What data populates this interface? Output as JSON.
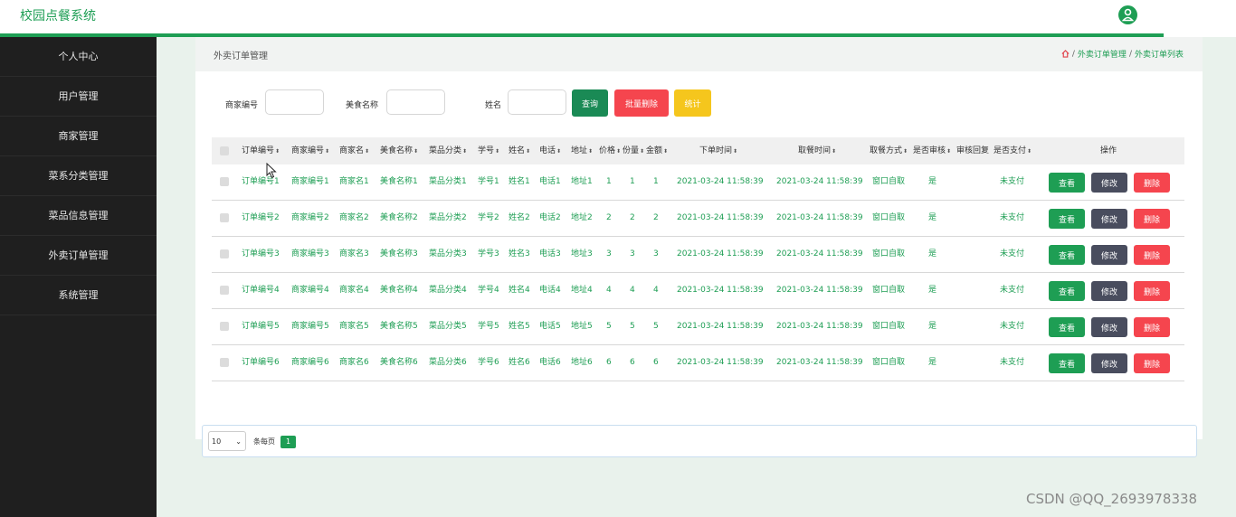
{
  "app": {
    "title": "校园点餐系统"
  },
  "sidebar": {
    "items": [
      {
        "label": "个人中心"
      },
      {
        "label": "用户管理"
      },
      {
        "label": "商家管理"
      },
      {
        "label": "菜系分类管理"
      },
      {
        "label": "菜品信息管理"
      },
      {
        "label": "外卖订单管理"
      },
      {
        "label": "系统管理"
      }
    ]
  },
  "page": {
    "title": "外卖订单管理",
    "breadcrumb": {
      "home_icon": "home-icon",
      "section": "外卖订单管理",
      "current": "外卖订单列表"
    }
  },
  "search": {
    "merchant_id_label": "商家编号",
    "merchant_id_value": "",
    "food_name_label": "美食名称",
    "food_name_value": "",
    "name_label": "姓名",
    "name_value": "",
    "query_button": "查询",
    "batch_delete_button": "批量删除",
    "stats_button": "统计"
  },
  "table": {
    "headers": [
      "订单编号",
      "商家编号",
      "商家名",
      "美食名称",
      "菜品分类",
      "学号",
      "姓名",
      "电话",
      "地址",
      "价格",
      "份量",
      "金额",
      "下单时间",
      "取餐时间",
      "取餐方式",
      "是否审核",
      "审核回复",
      "是否支付",
      "操作"
    ],
    "rows": [
      [
        "订单编号1",
        "商家编号1",
        "商家名1",
        "美食名称1",
        "菜品分类1",
        "学号1",
        "姓名1",
        "电话1",
        "地址1",
        "1",
        "1",
        "1",
        "2021-03-24 11:58:39",
        "2021-03-24 11:58:39",
        "窗口自取",
        "是",
        "",
        "未支付"
      ],
      [
        "订单编号2",
        "商家编号2",
        "商家名2",
        "美食名称2",
        "菜品分类2",
        "学号2",
        "姓名2",
        "电话2",
        "地址2",
        "2",
        "2",
        "2",
        "2021-03-24 11:58:39",
        "2021-03-24 11:58:39",
        "窗口自取",
        "是",
        "",
        "未支付"
      ],
      [
        "订单编号3",
        "商家编号3",
        "商家名3",
        "美食名称3",
        "菜品分类3",
        "学号3",
        "姓名3",
        "电话3",
        "地址3",
        "3",
        "3",
        "3",
        "2021-03-24 11:58:39",
        "2021-03-24 11:58:39",
        "窗口自取",
        "是",
        "",
        "未支付"
      ],
      [
        "订单编号4",
        "商家编号4",
        "商家名4",
        "美食名称4",
        "菜品分类4",
        "学号4",
        "姓名4",
        "电话4",
        "地址4",
        "4",
        "4",
        "4",
        "2021-03-24 11:58:39",
        "2021-03-24 11:58:39",
        "窗口自取",
        "是",
        "",
        "未支付"
      ],
      [
        "订单编号5",
        "商家编号5",
        "商家名5",
        "美食名称5",
        "菜品分类5",
        "学号5",
        "姓名5",
        "电话5",
        "地址5",
        "5",
        "5",
        "5",
        "2021-03-24 11:58:39",
        "2021-03-24 11:58:39",
        "窗口自取",
        "是",
        "",
        "未支付"
      ],
      [
        "订单编号6",
        "商家编号6",
        "商家名6",
        "美食名称6",
        "菜品分类6",
        "学号6",
        "姓名6",
        "电话6",
        "地址6",
        "6",
        "6",
        "6",
        "2021-03-24 11:58:39",
        "2021-03-24 11:58:39",
        "窗口自取",
        "是",
        "",
        "未支付"
      ]
    ],
    "actions": {
      "view": "查看",
      "edit": "修改",
      "delete": "删除"
    }
  },
  "pagination": {
    "page_size": "10",
    "per_page_label": "条每页",
    "current_page": "1"
  },
  "watermark": "CSDN @QQ_2693978338",
  "colors": {
    "primary": "#1e9e54",
    "danger": "#f5454e",
    "warning": "#f5c61d",
    "dark": "#494d5e",
    "sidebar": "#1f1f1f"
  }
}
